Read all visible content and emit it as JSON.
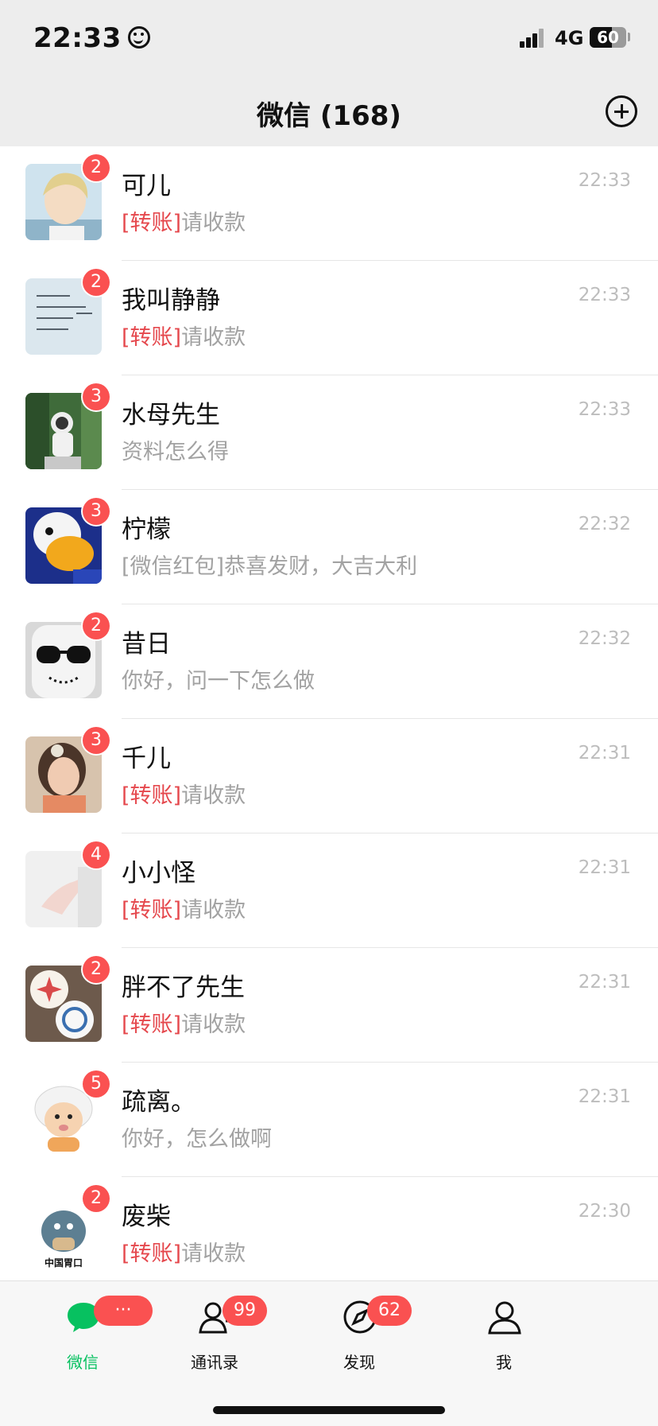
{
  "status_bar": {
    "time": "22:33",
    "network": "4G",
    "battery": "60",
    "battery_level": 0.6
  },
  "nav": {
    "title": "微信 (168)",
    "add_icon": "plus-circle-icon"
  },
  "chats": [
    {
      "name": "可儿",
      "tag": "[转账]",
      "preview": "请收款",
      "time": "22:33",
      "unread": "2"
    },
    {
      "name": "我叫静静",
      "tag": "[转账]",
      "preview": "请收款",
      "time": "22:33",
      "unread": "2"
    },
    {
      "name": "水母先生",
      "tag": "",
      "preview": "资料怎么得",
      "time": "22:33",
      "unread": "3"
    },
    {
      "name": "柠檬",
      "tag": "",
      "preview": "[微信红包]恭喜发财，大吉大利",
      "time": "22:32",
      "unread": "3"
    },
    {
      "name": "昔日",
      "tag": "",
      "preview": "你好，问一下怎么做",
      "time": "22:32",
      "unread": "2"
    },
    {
      "name": "千儿",
      "tag": "[转账]",
      "preview": "请收款",
      "time": "22:31",
      "unread": "3"
    },
    {
      "name": "小小怪",
      "tag": "[转账]",
      "preview": "请收款",
      "time": "22:31",
      "unread": "4"
    },
    {
      "name": "胖不了先生",
      "tag": "[转账]",
      "preview": "请收款",
      "time": "22:31",
      "unread": "2"
    },
    {
      "name": "疏离。",
      "tag": "",
      "preview": "你好，怎么做啊",
      "time": "22:31",
      "unread": "5"
    },
    {
      "name": "废柴",
      "tag": "[转账]",
      "preview": "请收款",
      "time": "22:30",
      "unread": "2",
      "avatar_text": "中国胃口"
    }
  ],
  "tabs": [
    {
      "label": "微信",
      "badge": "···",
      "icon": "chat-bubble-icon",
      "active": true
    },
    {
      "label": "通讯录",
      "badge": "99",
      "icon": "contacts-icon",
      "active": false
    },
    {
      "label": "发现",
      "badge": "62",
      "icon": "compass-icon",
      "active": false
    },
    {
      "label": "我",
      "badge": "",
      "icon": "person-icon",
      "active": false
    }
  ],
  "colors": {
    "accent_green": "#07c160",
    "badge_red": "#fa5151",
    "highlight_red": "#e5484d"
  }
}
